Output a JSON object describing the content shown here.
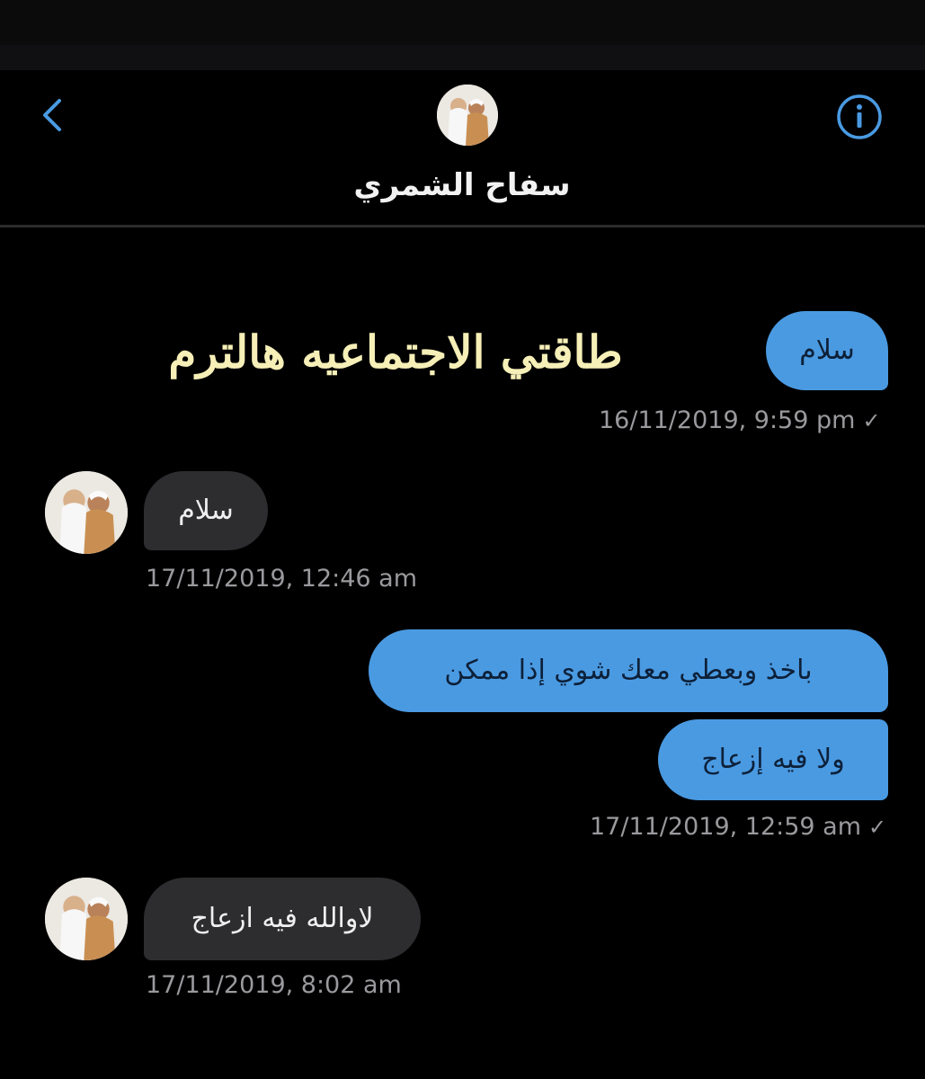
{
  "header": {
    "contact_name": "سفاح الشمري",
    "back_icon": "chevron-left-icon",
    "info_icon": "info-icon",
    "accent_color": "#4a9ae2"
  },
  "overlay_caption": "طاقتي الاجتماعيه هالترم",
  "messages": [
    {
      "direction": "outgoing",
      "text": "سلام",
      "timestamp": "16/11/2019, 9:59 pm",
      "read_check": "✓"
    },
    {
      "direction": "incoming",
      "text": "سلام",
      "timestamp": "17/11/2019, 12:46 am"
    },
    {
      "direction": "outgoing",
      "text": "باخذ وبعطي معك شوي إذا ممكن",
      "timestamp": null
    },
    {
      "direction": "outgoing",
      "text": "ولا فيه إزعاج",
      "timestamp": "17/11/2019, 12:59 am",
      "read_check": "✓"
    },
    {
      "direction": "incoming",
      "text": "لاوالله فيه ازعاج",
      "timestamp": "17/11/2019, 8:02 am"
    }
  ],
  "colors": {
    "background": "#000000",
    "outgoing_bubble": "#4a9ae2",
    "incoming_bubble": "#2d2d30",
    "timestamp": "#9a9a9e",
    "caption": "#f6efb7"
  }
}
